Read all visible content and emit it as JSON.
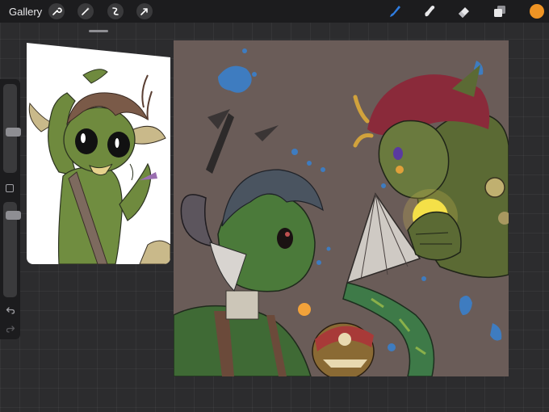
{
  "topbar": {
    "gallery_label": "Gallery",
    "left_tools": [
      "wrench-icon",
      "magic-wand-icon",
      "selection-icon",
      "transform-icon"
    ],
    "right_tools": [
      "brush-icon",
      "smudge-icon",
      "eraser-icon",
      "layers-icon"
    ],
    "active_tool": "brush-icon",
    "brush_color": "#2f7de1",
    "current_color": "#ef9424"
  },
  "sidebar": {
    "brush_size_level": 0.45,
    "brush_opacity_level": 0.9
  },
  "colors": {
    "background": "#2c2c2e",
    "bar": "#1c1c1e",
    "canvas": "#6a5c58"
  }
}
